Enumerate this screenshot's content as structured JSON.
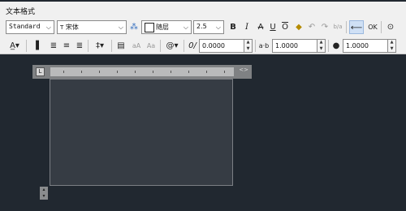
{
  "window": {
    "title": "文本格式"
  },
  "toolbar1": {
    "style_value": "Standard",
    "font_value": "宋体",
    "font_prefix": "T",
    "color_value": "随层",
    "height_value": "2.5",
    "bold": "B",
    "italic": "I",
    "strike": "A",
    "underline": "U",
    "overline": "O",
    "undo": "↶",
    "redo": "↷",
    "stack": "b/a",
    "ok_label": "OK"
  },
  "toolbar2": {
    "obliquing_value": "0.0000",
    "tracking_label": "a·b",
    "tracking_value": "1.0000",
    "width_value": "1.0000",
    "at_symbol": "@",
    "slash_symbol": "0/"
  },
  "ruler": {
    "corner": "L",
    "arrows": "<>"
  },
  "colors": {
    "background": "#212830",
    "editor": "#363c44",
    "accent": "#cfe0f5"
  }
}
